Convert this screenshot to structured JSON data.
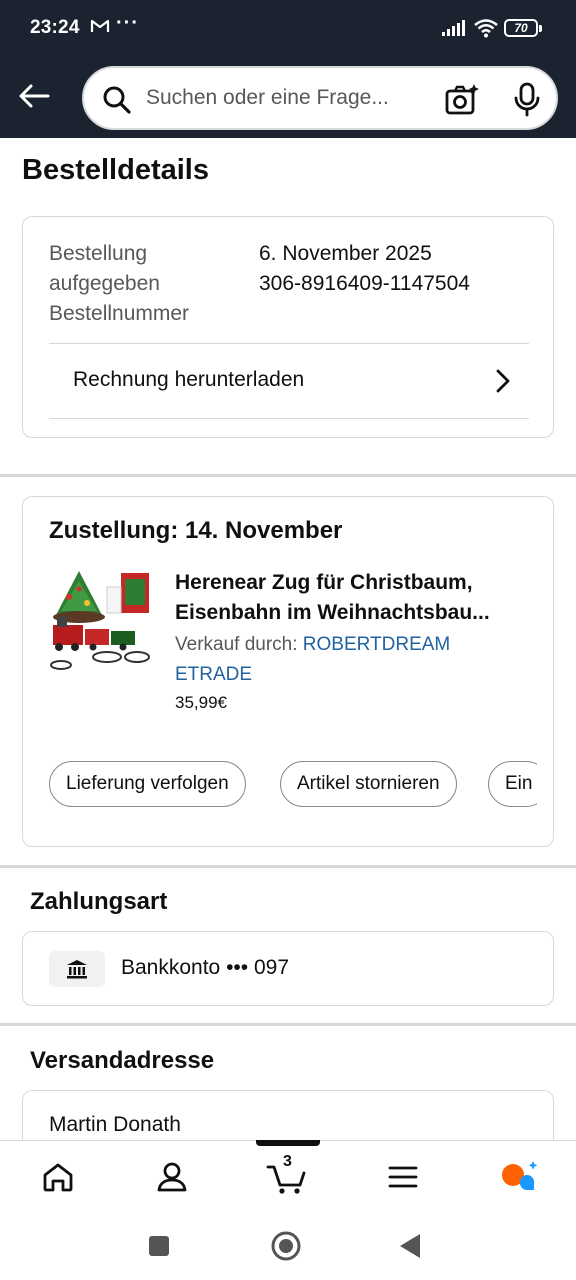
{
  "status_bar": {
    "time": "23:24",
    "battery": "70"
  },
  "search": {
    "placeholder": "Suchen oder eine Frage..."
  },
  "page": {
    "title": "Bestelldetails"
  },
  "order_summary": {
    "label_lines": [
      "Bestellung",
      "aufgegeben",
      "Bestellnummer"
    ],
    "date": "6. November 2025",
    "order_number": "306-8916409-1147504",
    "invoice_label": "Rechnung herunterladen"
  },
  "delivery": {
    "title": "Zustellung: 14. November",
    "product_title": "Herenear Zug für Christbaum, Eisenbahn im Weihnachtsbau...",
    "seller_prefix": "Verkauf durch: ",
    "seller_name": "ROBERTDREAM ETRADE",
    "price": "35,99€",
    "actions": [
      "Lieferung verfolgen",
      "Artikel stornieren",
      "Ein"
    ]
  },
  "payment": {
    "title": "Zahlungsart",
    "method": "Bankkonto ••• 097"
  },
  "shipping": {
    "title": "Versandadresse",
    "name": "Martin Donath"
  },
  "bottom_nav": {
    "cart_count": "3",
    "items": [
      "home-icon",
      "account-icon",
      "cart-icon",
      "menu-icon",
      "rufus-icon"
    ]
  },
  "colors": {
    "header_bg": "#1b2330",
    "link": "#2162a1",
    "border": "#d5d9d9",
    "accent_orange": "#ff6200",
    "accent_blue": "#1a98ff"
  }
}
